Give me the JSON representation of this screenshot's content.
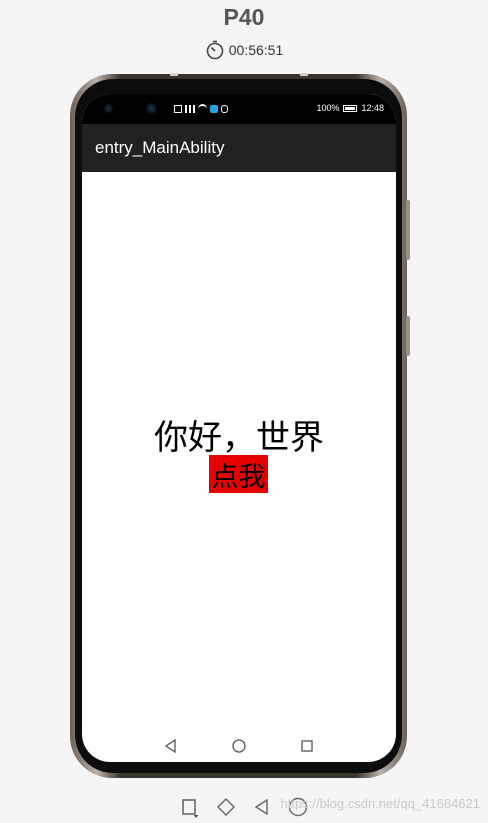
{
  "device": {
    "name": "P40",
    "timer": "00:56:51"
  },
  "status_bar": {
    "battery": "100%",
    "time": "12:48"
  },
  "app": {
    "title": "entry_MainAbility"
  },
  "content": {
    "greeting": "你好，世界",
    "button_label": "点我",
    "button_color": "#e60000"
  },
  "nav_bar": {
    "items": [
      "back-icon",
      "home-icon",
      "recents-icon"
    ]
  },
  "toolbar": {
    "items": [
      "rotate-icon",
      "eraser-icon",
      "back-icon",
      "home-icon"
    ]
  },
  "watermark": "https://blog.csdn.net/qq_41684621"
}
